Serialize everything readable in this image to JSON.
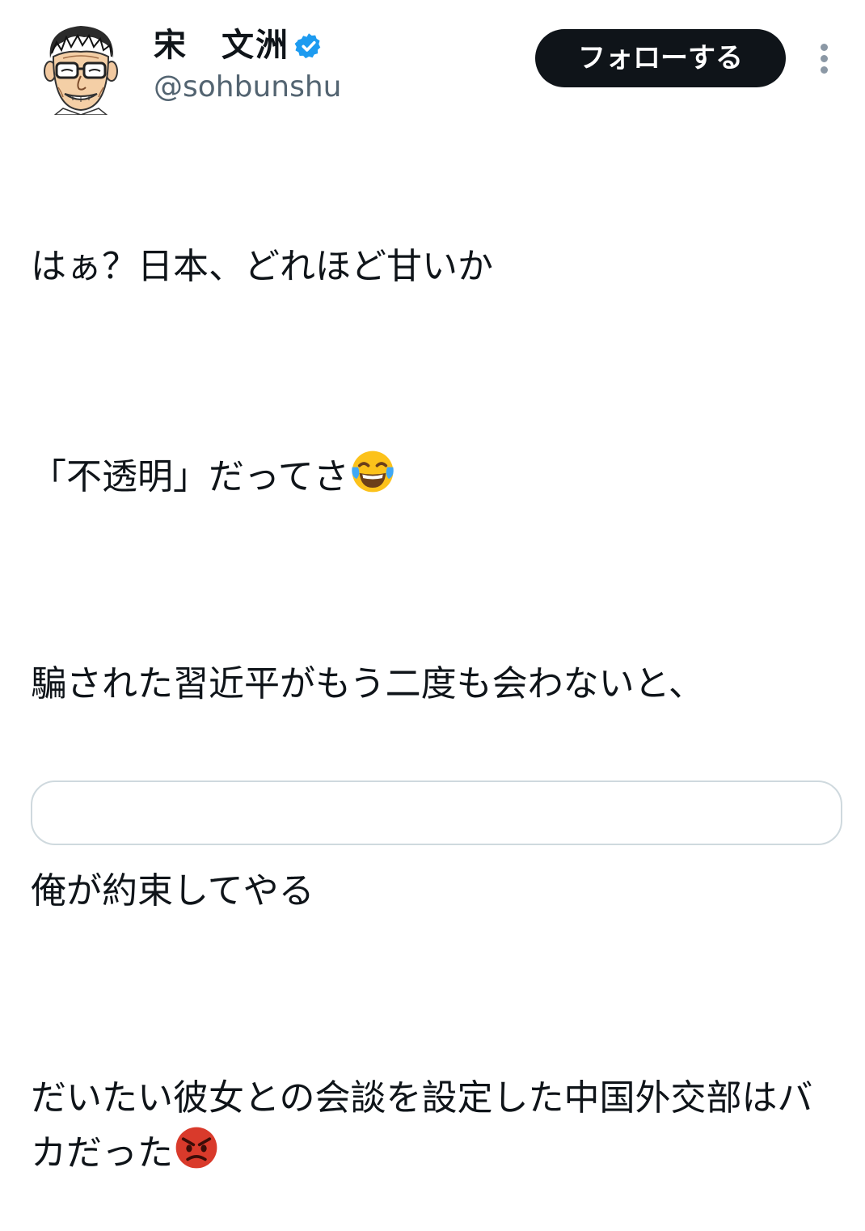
{
  "author": {
    "display_name": "宋　文洲",
    "handle": "@sohbunshu",
    "avatar": "caricature-avatar",
    "verified_icon": "verified-badge-icon",
    "verified_color": "#1d9bf0"
  },
  "actions": {
    "follow_label": "フォローする",
    "more_icon": "more-vertical-icon"
  },
  "tweet": {
    "paragraphs": [
      "はぁ？日本、どれほど甘いか",
      "「不透明」だってさ",
      "騙された習近平がもう二度も会わないと、",
      "俺が約束してやる",
      "だいたい彼女との会談を設定した中国外交部はバカだった"
    ],
    "emoji_p2": "face-with-tears-of-joy-emoji",
    "emoji_p5": "angry-face-emoji"
  },
  "colors": {
    "text": "#0f1419",
    "secondary": "#536471",
    "button_bg": "#0f1419",
    "button_text": "#ffffff",
    "border": "#cfd9de"
  }
}
